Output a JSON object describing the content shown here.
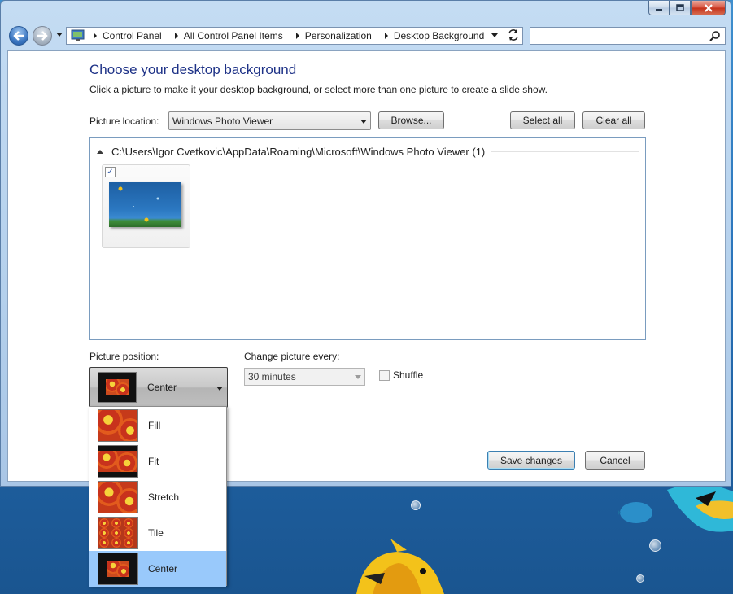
{
  "window": {
    "caption_buttons": [
      "minimize-icon",
      "maximize-icon",
      "close-icon"
    ]
  },
  "address_bar": {
    "icon": "control-panel-icon",
    "crumbs": [
      "Control Panel",
      "All Control Panel Items",
      "Personalization",
      "Desktop Background"
    ],
    "search_placeholder": ""
  },
  "page": {
    "title": "Choose your desktop background",
    "subtitle": "Click a picture to make it your desktop background, or select more than one picture to create a slide show.",
    "picture_location_label": "Picture location:",
    "picture_location_value": "Windows Photo Viewer",
    "browse_label": "Browse...",
    "select_all_label": "Select all",
    "clear_all_label": "Clear all"
  },
  "gallery": {
    "group_path": "C:\\Users\\Igor Cvetkovic\\AppData\\Roaming\\Microsoft\\Windows Photo Viewer (1)",
    "thumbnails": [
      {
        "checked": true,
        "checkmark": "✓"
      }
    ]
  },
  "position": {
    "label": "Picture position:",
    "selected": "Center",
    "options": [
      "Fill",
      "Fit",
      "Stretch",
      "Tile",
      "Center"
    ]
  },
  "slideshow": {
    "label": "Change picture every:",
    "interval": "30 minutes",
    "shuffle_label": "Shuffle",
    "shuffle_checked": false
  },
  "footer": {
    "save_label": "Save changes",
    "cancel_label": "Cancel"
  },
  "colors": {
    "title": "#1e3287",
    "selected_option": "#99c9fb",
    "desktop": "#2a74bb"
  }
}
